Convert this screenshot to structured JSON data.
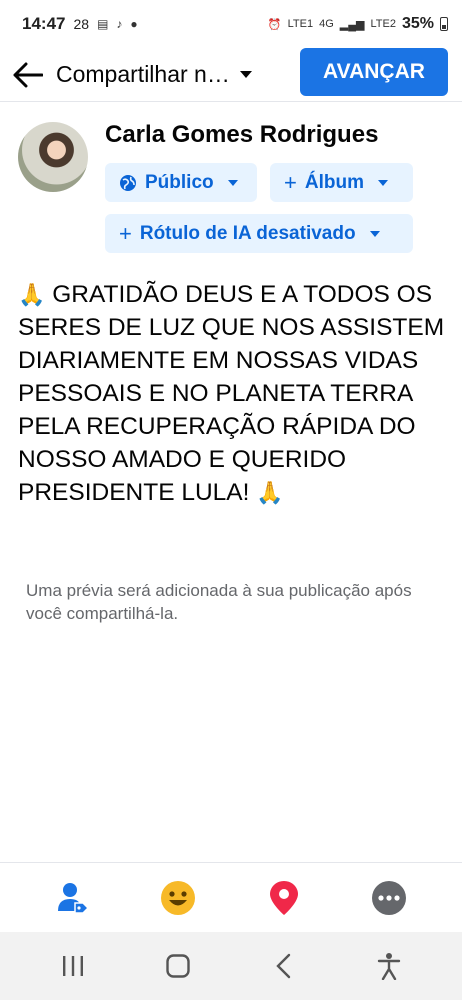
{
  "status_bar": {
    "time": "14:47",
    "temperature": "28",
    "battery": "35%",
    "icons": [
      "pdf-icon",
      "tiktok-icon",
      "dot-icon",
      "alarm-icon",
      "volte1-icon",
      "4g-icon",
      "signal-icon",
      "volte2-icon",
      "battery-icon"
    ]
  },
  "header": {
    "title": "Compartilhar n…",
    "next_label": "AVANÇAR",
    "icons": [
      "back-arrow-icon",
      "chevron-down-icon"
    ]
  },
  "author": {
    "name": "Carla Gomes Rodrigues"
  },
  "chips": {
    "public_label": "Público",
    "album_label": "Álbum",
    "ai_label": "Rótulo de IA desativado"
  },
  "post": {
    "text": "GRATIDÃO DEUS E A TODOS OS SERES DE LUZ QUE NOS ASSISTEM DIARIAMENTE EM NOSSAS VIDAS PESSOAIS E NO PLANETA TERRA PELA RECUPERAÇÃO RÁPIDA DO NOSSO AMADO E QUERIDO PRESIDENTE LULA!",
    "emoji": "🙏"
  },
  "preview_note": "Uma prévia será adicionada à sua publicação após você compartilhá-la.",
  "toolbar": {
    "items": [
      "tag-people-icon",
      "feeling-icon",
      "location-pin-icon",
      "more-icon"
    ],
    "colors": {
      "tag": "#1b74e4",
      "feeling": "#f7b928",
      "location": "#f02849",
      "more": "#65676b"
    }
  },
  "nav": {
    "items": [
      "recent-apps-icon",
      "home-icon",
      "back-icon",
      "accessibility-icon"
    ]
  },
  "colors": {
    "accent": "#1b74e4",
    "chip_bg": "#e7f3ff",
    "chip_text": "#0a64d6"
  }
}
